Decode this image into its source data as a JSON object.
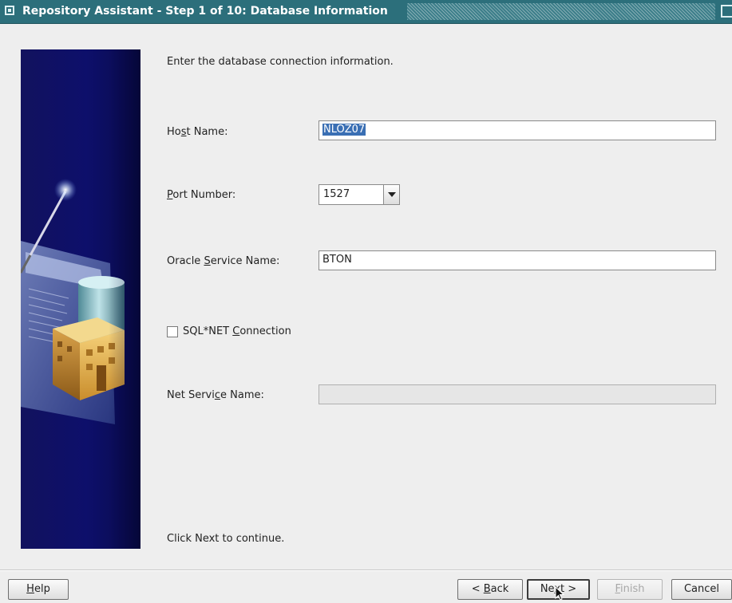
{
  "window": {
    "title": "Repository Assistant - Step 1 of 10: Database Information"
  },
  "content": {
    "instruction": "Enter the database connection information.",
    "footer_hint": "Click Next to continue."
  },
  "form": {
    "host_name": {
      "label": "Host Name:",
      "value": "NLOZ07"
    },
    "port_number": {
      "label": "Port Number:",
      "value": "1527"
    },
    "oracle_service_name": {
      "label": "Oracle Service Name:",
      "value": "BTON"
    },
    "sqlnet_connection": {
      "label": "SQL*NET Connection",
      "checked": false
    },
    "net_service_name": {
      "label": "Net Service Name:",
      "value": ""
    }
  },
  "buttons": {
    "help": "Help",
    "back": "< Back",
    "next": "Next >",
    "finish": "Finish",
    "cancel": "Cancel"
  },
  "icons": {
    "title": "window-menu-icon",
    "banner": "database-building-illustration",
    "cursor": "mouse-pointer-icon"
  },
  "colors": {
    "titlebar": "#2c6f7b",
    "banner": "#0d0f6b",
    "selection": "#3a6fb4"
  }
}
